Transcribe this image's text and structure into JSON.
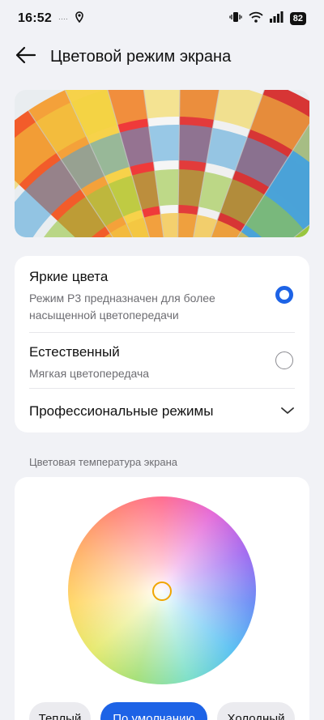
{
  "status_bar": {
    "time": "16:52",
    "small_dots": "····",
    "battery": "82"
  },
  "header": {
    "title": "Цветовой режим экрана"
  },
  "modes": {
    "vivid": {
      "title": "Яркие цвета",
      "desc_line1": "Режим P3 предназначен для более",
      "desc_line2": "насыщенной цветопередачи",
      "selected": true
    },
    "natural": {
      "title": "Естественный",
      "desc": "Мягкая цветопередача",
      "selected": false
    },
    "professional": {
      "title": "Профессиональные режимы"
    }
  },
  "temperature": {
    "section_label": "Цветовая температура экрана",
    "buttons": {
      "warm": "Теплый",
      "default": "По умолчанию",
      "cold": "Холодный"
    },
    "selected": "default"
  },
  "colors": {
    "accent": "#1d63e6",
    "knob": "#f0a500",
    "background": "#f1f2f6"
  },
  "icons": [
    "vibrate-icon",
    "wifi-icon",
    "signal-icon",
    "battery-icon",
    "location-icon",
    "back-arrow-icon",
    "chevron-down-icon"
  ]
}
